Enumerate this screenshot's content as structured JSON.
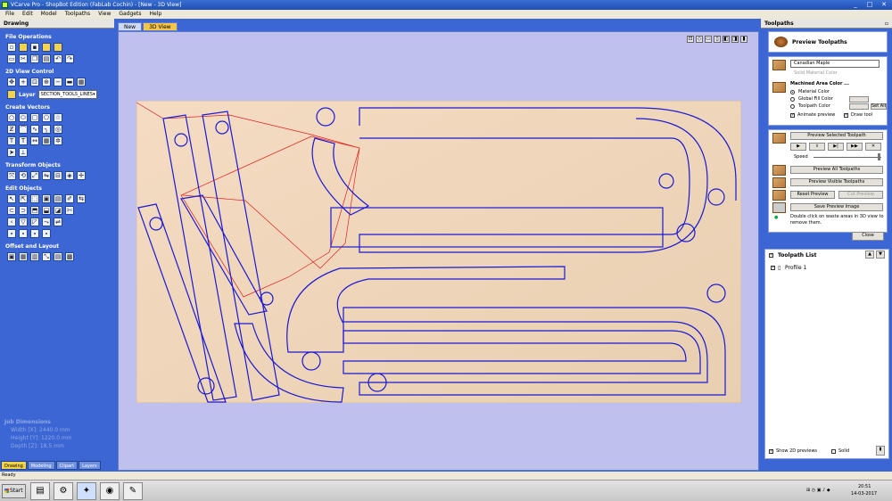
{
  "window": {
    "title": "VCarve Pro - ShopBot Edition (FabLab Cochin) - [New - 3D View]",
    "controls": [
      "_",
      "□",
      "✕"
    ]
  },
  "menu": [
    "File",
    "Edit",
    "Model",
    "Toolpaths",
    "View",
    "Gadgets",
    "Help"
  ],
  "left_panel": {
    "title": "Drawing",
    "sections": {
      "file_ops": "File Operations",
      "view_ctrl": "2D View Control",
      "create": "Create Vectors",
      "transform": "Transform Objects",
      "edit": "Edit Objects",
      "offset": "Offset and Layout"
    },
    "layer_label": "Layer",
    "layer_value": "SECTION_TOOLS_LINES",
    "job": {
      "title": "Job Dimensions",
      "width": "Width  [X]: 2440.0 mm",
      "height": "Height [Y]: 1220.0 mm",
      "depth": "Depth  [Z]: 18.5 mm"
    },
    "tabs": [
      "Drawing",
      "Modeling",
      "Clipart",
      "Layers"
    ]
  },
  "view_tabs": [
    "New",
    "3D View"
  ],
  "right_panel": {
    "title": "Toolpaths",
    "preview_title": "Preview Toolpaths",
    "material": "Canadian Maple",
    "solid_label": "Solid Material Color",
    "machined_label": "Machined Area Color ...",
    "opt_material": "Material Color",
    "opt_global": "Global Fill Color",
    "opt_toolpath": "Toolpath Color",
    "set_all": "Set All",
    "animate": "Animate preview",
    "draw_tool": "Draw tool",
    "btn_preview_selected": "Preview Selected Toolpath",
    "speed_label": "Speed",
    "btn_preview_all": "Preview All Toolpaths",
    "btn_preview_visible": "Preview Visible Toolpaths",
    "btn_reset": "Reset Preview",
    "btn_cut_preview": "Cut Preview",
    "btn_save": "Save Preview Image",
    "hint": "Double click on waste areas in 3D view to remove them.",
    "btn_close": "Close",
    "list_title": "Toolpath List",
    "toolpath": "Profile 1",
    "show_2d": "Show 2D previews",
    "solid": "Solid"
  },
  "status": {
    "text": "Ready"
  },
  "tray": {
    "time": "20:51",
    "date": "14-03-2017"
  },
  "colors": {
    "panel": "#3c66d4",
    "viewport": "#c0c0ec",
    "vector": "#1a1ad4",
    "toolpath_move": "#e02020",
    "highlight": "#f5c54c"
  }
}
